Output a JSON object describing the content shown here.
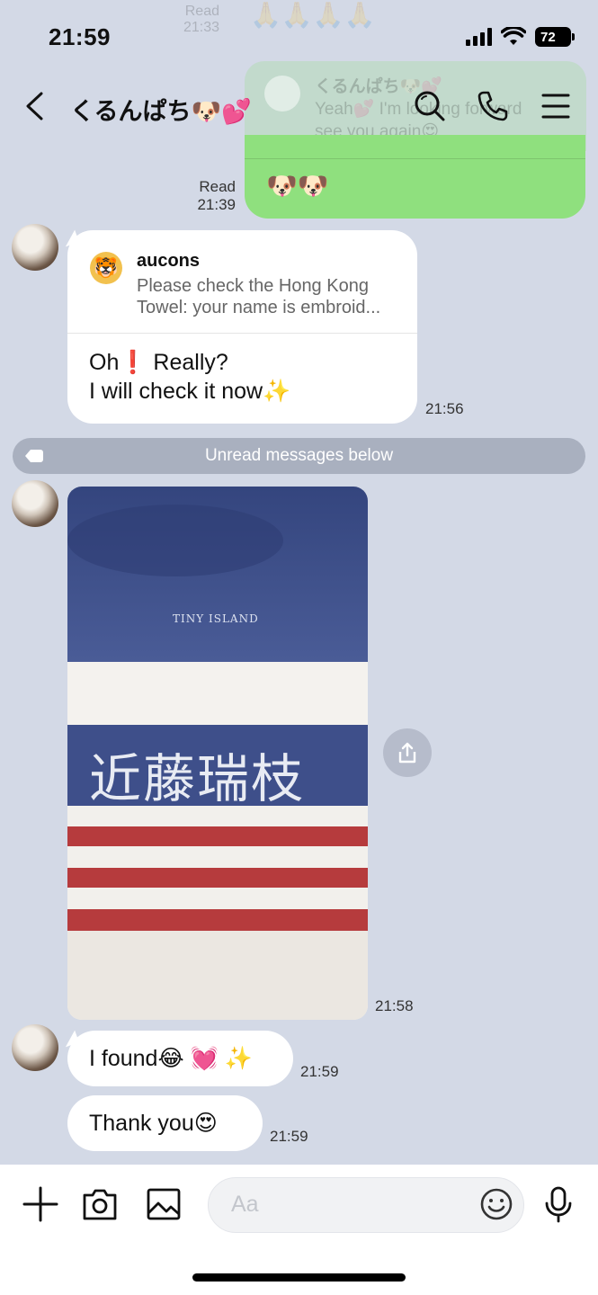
{
  "status_bar": {
    "time": "21:59",
    "battery": "72"
  },
  "ghost_top": {
    "read": "Read",
    "time": "21:33",
    "emoji": "🙏🙏🙏🙏"
  },
  "ghost_quote": {
    "name": "くるんぱち🐶💕",
    "line1": "Yeah💕 I'm looking forward",
    "line2": "see you again😍"
  },
  "header": {
    "title": "くるんぱち🐶💕"
  },
  "messages": {
    "green": {
      "emoji": "🐶🐶",
      "read": "Read",
      "time": "21:39"
    },
    "reply": {
      "quote_name": "aucons",
      "quote_line1": "Please check the Hong Kong",
      "quote_line2": "Towel: your name is embroid...",
      "line1": "Oh❗ Really?",
      "line2": "I will check it now✨",
      "time": "21:56"
    },
    "unread_label": "Unread messages below",
    "photo": {
      "brand_text": "TINY ISLAND",
      "embroidered_name": "近藤瑞枝",
      "time": "21:58"
    },
    "found": {
      "text": "I found😂 💓 ✨",
      "time": "21:59"
    },
    "thanks": {
      "text": "Thank you😍",
      "time": "21:59"
    }
  },
  "input": {
    "placeholder": "Aa"
  },
  "colors": {
    "background": "#d3d9e6",
    "sent_bubble": "#8fe07e",
    "towel_navy": "#3f4f88",
    "towel_red": "#b23a3c"
  }
}
